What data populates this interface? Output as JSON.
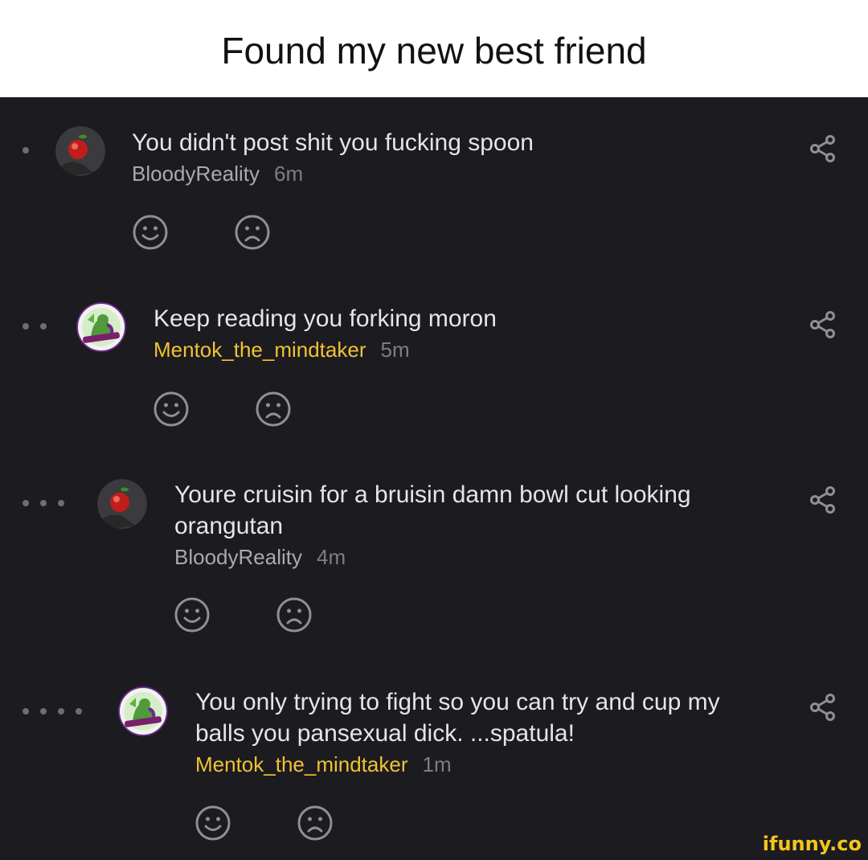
{
  "header": {
    "title": "Found my new best friend"
  },
  "comments": [
    {
      "text": "You didn't post shit you fucking spoon",
      "user": "BloodyReality",
      "time": "6m",
      "depth": 1,
      "avatar": "apple-avatar-icon"
    },
    {
      "text": "Keep reading you forking moron",
      "user": "Mentok_the_mindtaker",
      "time": "5m",
      "depth": 2,
      "avatar": "mentok-avatar-icon"
    },
    {
      "text": "Youre cruisin for a bruisin damn bowl cut looking orangutan",
      "user": "BloodyReality",
      "time": "4m",
      "depth": 3,
      "avatar": "apple-avatar-icon"
    },
    {
      "text": "You only trying to fight so you can try and cup my balls you pansexual dick. ...spatula!",
      "user": "Mentok_the_mindtaker",
      "time": "1m",
      "depth": 4,
      "avatar": "mentok-avatar-icon"
    }
  ],
  "icons": {
    "smile": "smile-icon",
    "frown": "frown-icon",
    "share": "share-icon"
  },
  "colors": {
    "background": "#1b1b20",
    "text": "#e4e5ea",
    "username_grey": "#a9aab0",
    "username_gold": "#f1c232",
    "icon": "#8f9096",
    "watermark": "#f5c518"
  },
  "watermark": "ifunny.co"
}
